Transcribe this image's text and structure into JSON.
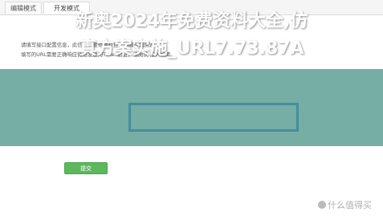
{
  "tabs": [
    {
      "label": "编辑模式"
    },
    {
      "label": "开发模式"
    }
  ],
  "description": {
    "line1": "请填写接口配置信息，此信息需要你拥有自己的服务器资源。",
    "line2": "填写的URL需要正确响应微信发送的Token验证，请阅读 接入指南。"
  },
  "banner": {
    "line1": "新奥2024年免费资料大全,仿",
    "line2": "真方案实施_URL7.73.87A"
  },
  "submit_label": "提交",
  "watermark": "什么值得买"
}
